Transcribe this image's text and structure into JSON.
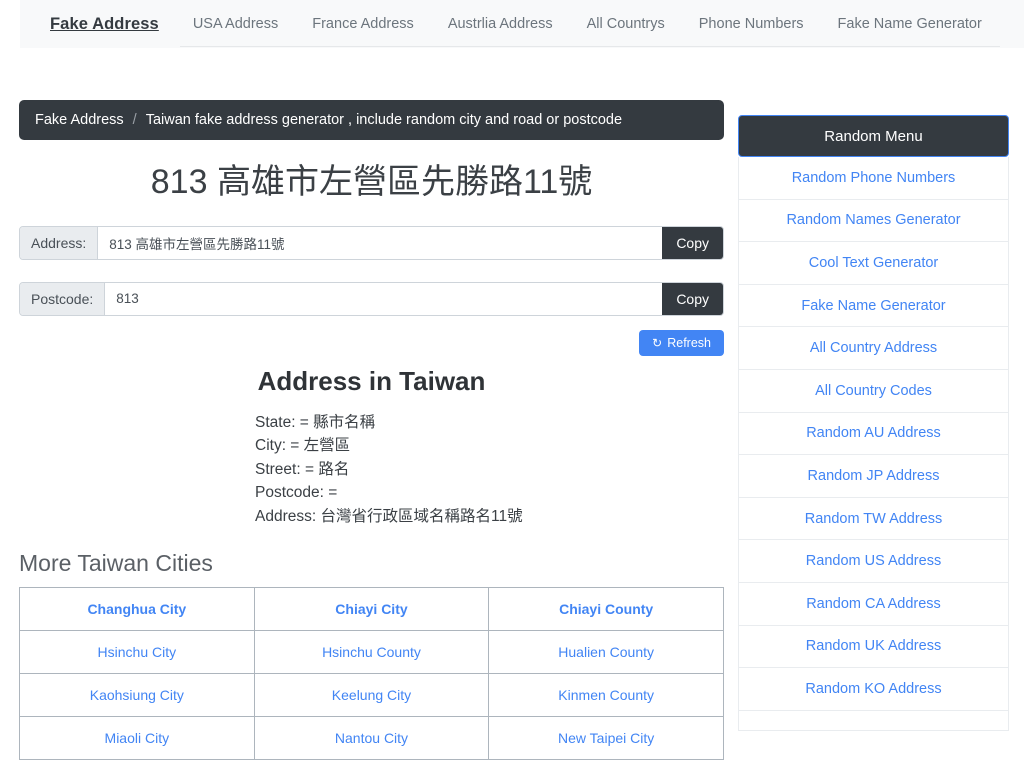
{
  "topnav": {
    "brand": "Fake Address",
    "links": [
      "USA Address",
      "France Address",
      "Austrlia Address",
      "All Countrys",
      "Phone Numbers",
      "Fake Name Generator"
    ]
  },
  "breadcrumb": {
    "root": "Fake Address",
    "separator": "/",
    "current": "Taiwan fake address generator , include random city and road or postcode"
  },
  "main": {
    "address_title": "813 高雄市左營區先勝路11號",
    "fields": [
      {
        "label": "Address:",
        "value": "813 高雄市左營區先勝路11號",
        "button": "Copy"
      },
      {
        "label": "Postcode:",
        "value": "813",
        "button": "Copy"
      }
    ],
    "refresh": {
      "icon": "↻",
      "label": "Refresh"
    },
    "detail": {
      "heading": "Address in Taiwan",
      "lines": [
        "State: = 縣市名稱",
        "City: = 左營區",
        "Street: = 路名",
        "Postcode: =",
        "Address: 台灣省行政區域名稱路名11號"
      ]
    },
    "cities": {
      "heading": "More Taiwan Cities",
      "rows": [
        [
          "Changhua City",
          "Chiayi City",
          "Chiayi County"
        ],
        [
          "Hsinchu City",
          "Hsinchu County",
          "Hualien County"
        ],
        [
          "Kaohsiung City",
          "Keelung City",
          "Kinmen County"
        ],
        [
          "Miaoli City",
          "Nantou City",
          "New Taipei City"
        ]
      ]
    }
  },
  "sidebar": {
    "title": "Random Menu",
    "items": [
      "Random Phone Numbers",
      "Random Names Generator",
      "Cool Text Generator",
      "Fake Name Generator",
      "All Country Address",
      "All Country Codes",
      "Random AU Address",
      "Random JP Address",
      "Random TW Address",
      "Random US Address",
      "Random CA Address",
      "Random UK Address",
      "Random KO Address"
    ]
  },
  "colors": {
    "link": "#4285f4",
    "dark": "#343a40",
    "navbar_bg": "#f8f9fa",
    "label_bg": "#e9ecef"
  }
}
